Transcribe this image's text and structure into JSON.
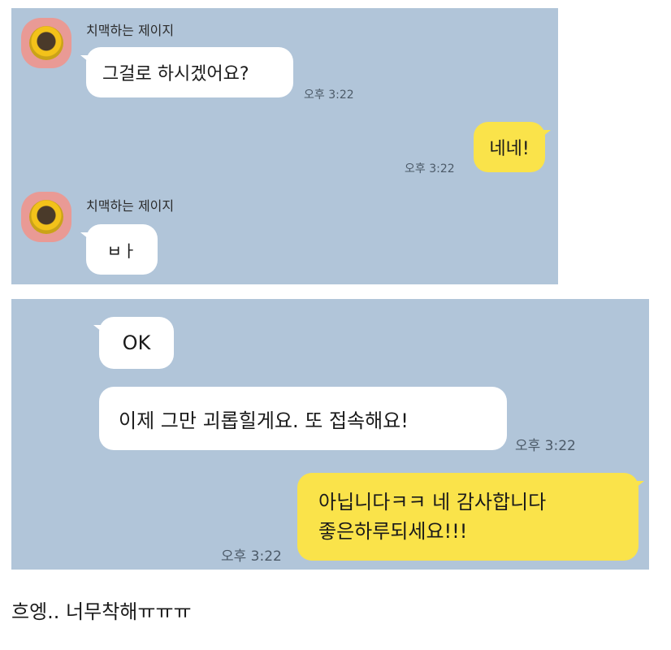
{
  "screenshot1": {
    "messages": [
      {
        "sender": "치맥하는 제이지",
        "text": "그걸로 하시겠어요?",
        "time": "오후 3:22"
      },
      {
        "text": "네네!",
        "time": "오후 3:22"
      },
      {
        "sender": "치맥하는 제이지",
        "text": "ㅂㅏ"
      }
    ]
  },
  "screenshot2": {
    "messages": [
      {
        "text": "OK"
      },
      {
        "text": "이제 그만 괴롭힐게요. 또 접속해요!",
        "time": "오후 3:22"
      },
      {
        "text_line1": "아닙니다ㅋㅋ 네 감사합니다",
        "text_line2": "좋은하루되세요!!!",
        "time": "오후 3:22"
      }
    ]
  },
  "caption": "흐엥.. 너무착해ㅠㅠㅠ",
  "colors": {
    "chat_background": "#b1c5d9",
    "incoming_bubble": "#ffffff",
    "outgoing_bubble": "#fae34a",
    "avatar_background": "#e99a95"
  },
  "icons": {
    "avatar": "yellow-character-avatar"
  }
}
